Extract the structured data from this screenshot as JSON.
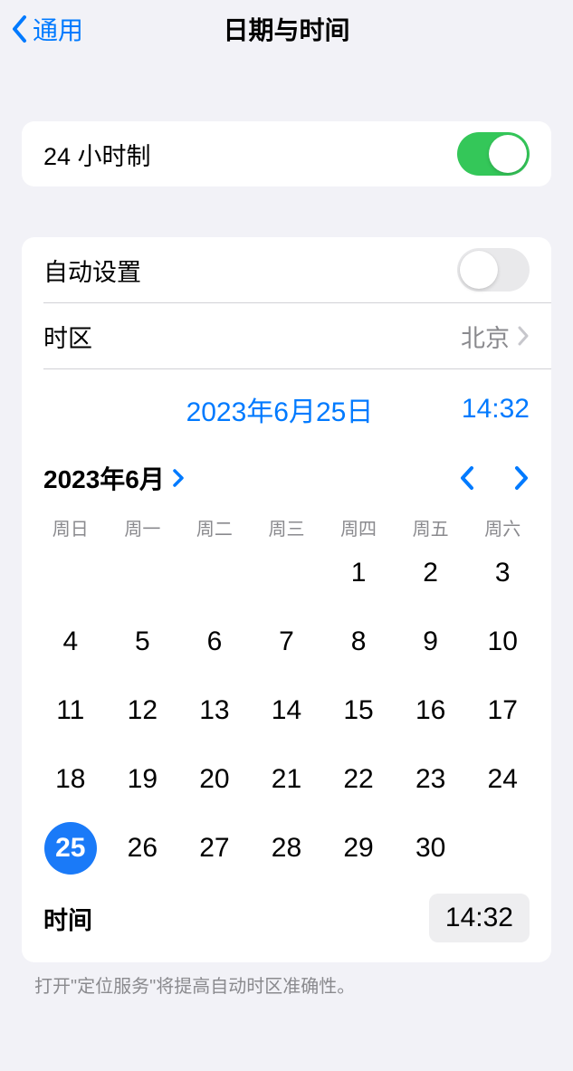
{
  "nav": {
    "back_label": "通用",
    "title": "日期与时间"
  },
  "twenty_four_hour": {
    "label": "24 小时制",
    "on": true
  },
  "auto_set": {
    "label": "自动设置",
    "on": false
  },
  "timezone": {
    "label": "时区",
    "value": "北京"
  },
  "selected": {
    "date_label": "2023年6月25日",
    "time_label": "14:32"
  },
  "calendar": {
    "month_label": "2023年6月",
    "weekdays": [
      "周日",
      "周一",
      "周二",
      "周三",
      "周四",
      "周五",
      "周六"
    ],
    "first_weekday_index": 4,
    "days_in_month": 30,
    "selected_day": 25
  },
  "time_row": {
    "label": "时间",
    "value": "14:32"
  },
  "footer": "打开\"定位服务\"将提高自动时区准确性。",
  "colors": {
    "accent": "#007aff",
    "toggle_on": "#34c759",
    "selected_day": "#1a7af8"
  }
}
